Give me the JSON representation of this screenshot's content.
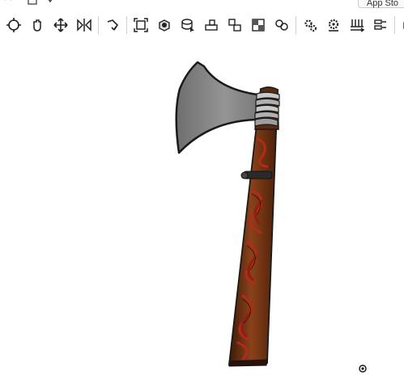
{
  "window": {
    "app_store_label": "App Sto"
  },
  "toolbar": {
    "buttons": [
      {
        "icon": "orbit-icon"
      },
      {
        "icon": "pan-icon"
      },
      {
        "icon": "move-icon"
      },
      {
        "icon": "section-view-icon"
      },
      {
        "icon": "rotate-view-icon"
      },
      {
        "icon": "zoom-fit-icon"
      },
      {
        "icon": "appearance-icon"
      },
      {
        "icon": "select-part-icon"
      },
      {
        "icon": "assembly-icon"
      },
      {
        "icon": "explode-icon"
      },
      {
        "icon": "display-mode-icon"
      },
      {
        "icon": "mates-icon"
      },
      {
        "icon": "gear-settings-icon"
      },
      {
        "icon": "motion-icon"
      },
      {
        "icon": "measure-icon"
      },
      {
        "icon": "properties-icon"
      },
      {
        "icon": "more-icon"
      }
    ]
  },
  "colors": {
    "blade": "#8c8c8c",
    "handle": "#6b2e12",
    "wrap": "#b32a1a",
    "outline": "#1a1a1a"
  }
}
